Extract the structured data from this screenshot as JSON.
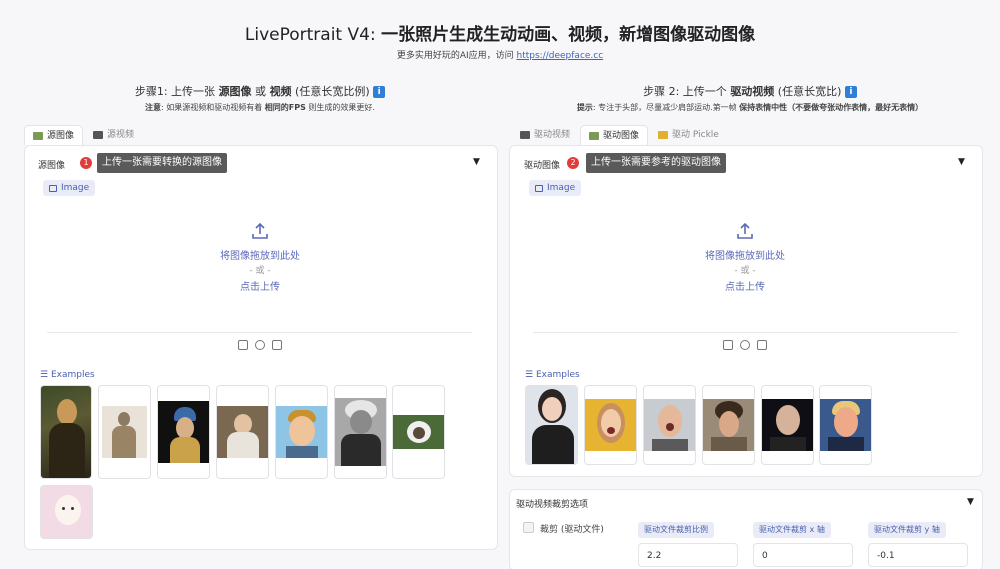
{
  "header": {
    "title_plain": "LivePortrait V4: ",
    "title_bold": "一张照片生成生动动画、视频，新增图像驱动图像",
    "subtitle_prefix": "更多实用好玩的AI应用，访问 ",
    "subtitle_link": "https://deepface.cc"
  },
  "left": {
    "step_prefix": "步骤1: 上传一张 ",
    "step_bold1": "源图像",
    "step_mid": " 或 ",
    "step_bold2": "视频",
    "step_suffix": " (任意长宽比例) ",
    "note_bold1": "注意",
    "note_text1": ": 如果源视频和驱动视频有着 ",
    "note_bold2": "相同的FPS",
    "note_text2": " 则生成的效果更好.",
    "tabs": [
      {
        "label": "源图像",
        "active": true
      },
      {
        "label": "源视频",
        "active": false
      }
    ],
    "panel_label": "源图像",
    "badge": "1",
    "tooltip": "上传一张需要转换的源图像",
    "image_pill": "Image",
    "drop_text": "将图像拖放到此处",
    "drop_or": "- 或 -",
    "drop_click": "点击上传",
    "examples_label": "Examples"
  },
  "right": {
    "step_prefix": "步骤 2: 上传一个 ",
    "step_bold": "驱动视频",
    "step_suffix": " (任意长宽比) ",
    "tip_bold1": "提示",
    "tip_text": ": 专注于头部，尽量减少肩部运动.第一帧 ",
    "tip_bold2": "保持表情中性",
    "tip_bold3": "（不要做夸张动作表情，最好无表情）",
    "tabs": [
      {
        "label": "驱动视频",
        "active": false
      },
      {
        "label": "驱动图像",
        "active": true
      },
      {
        "label": "驱动 Pickle",
        "active": false
      }
    ],
    "panel_label": "驱动图像",
    "badge": "2",
    "tooltip": "上传一张需要参考的驱动图像",
    "image_pill": "Image",
    "drop_text": "将图像拖放到此处",
    "drop_or": "- 或 -",
    "drop_click": "点击上传",
    "examples_label": "Examples"
  },
  "crop": {
    "title": "驱动视频裁剪选项",
    "checkbox_label": "裁剪 (驱动文件)",
    "fields": [
      {
        "label": "驱动文件裁剪比例",
        "value": "2.2"
      },
      {
        "label": "驱动文件裁剪 x 轴",
        "value": "0"
      },
      {
        "label": "驱动文件裁剪 y 轴",
        "value": "-0.1"
      }
    ]
  },
  "colors": {
    "accent": "#4a5fb0",
    "badge_red": "#e23b3b",
    "info_blue": "#2f7fd6"
  }
}
